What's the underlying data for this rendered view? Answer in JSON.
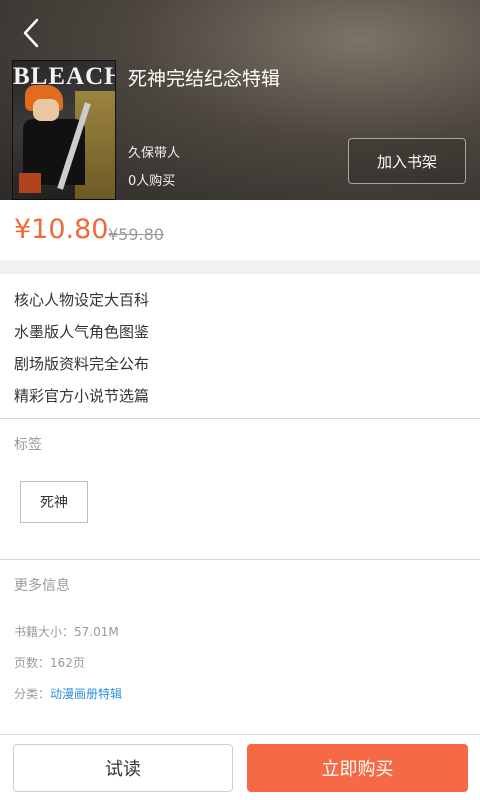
{
  "header": {
    "book_title": "死神完结纪念特辑",
    "author": "久保带人",
    "buyers": "0人购买",
    "add_to_shelf_label": "加入书架",
    "cover_logo": "BLEACH"
  },
  "price": {
    "current": "¥10.80",
    "original": "¥59.80",
    "accent_color": "#ef6a34"
  },
  "features": [
    "核心人物设定大百科",
    "水墨版人气角色图鉴",
    "剧场版资料完全公布",
    "精彩官方小说节选篇"
  ],
  "tags": {
    "heading": "标签",
    "items": [
      "死神"
    ]
  },
  "more_info": {
    "heading": "更多信息",
    "size_label": "书籍大小：",
    "size_value": "57.01M",
    "pages_label": "页数：",
    "pages_value": "162页",
    "category_label": "分类：",
    "category_value": "动漫画册特辑"
  },
  "actions": {
    "try_read_label": "试读",
    "buy_now_label": "立即购买",
    "buy_color": "#f56a44"
  },
  "icons": {
    "back": "chevron-left-icon"
  }
}
